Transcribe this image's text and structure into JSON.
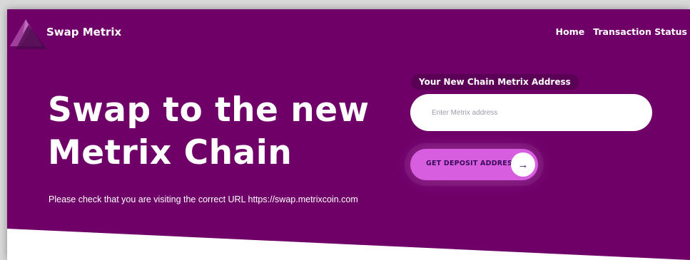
{
  "header": {
    "brand": "Swap Metrix",
    "logo_icon": "metrix-triangle-logo-icon",
    "nav": [
      {
        "label": "Home"
      },
      {
        "label": "Transaction Status"
      }
    ]
  },
  "hero": {
    "headline_line1": "Swap to the new",
    "headline_line2": "Metrix Chain",
    "notice": "Please check that you are visiting the correct URL https://swap.metrixcoin.com"
  },
  "form": {
    "label": "Your New Chain Metrix Address",
    "input_value": "",
    "input_placeholder": "Enter Metrix address",
    "button_label": "GET DEPOSIT ADDRESS",
    "button_icon": "arrow-right-icon"
  },
  "colors": {
    "hero_bg": "#6e0068",
    "button_bg": "#d85ee0",
    "text": "#ffffff"
  }
}
